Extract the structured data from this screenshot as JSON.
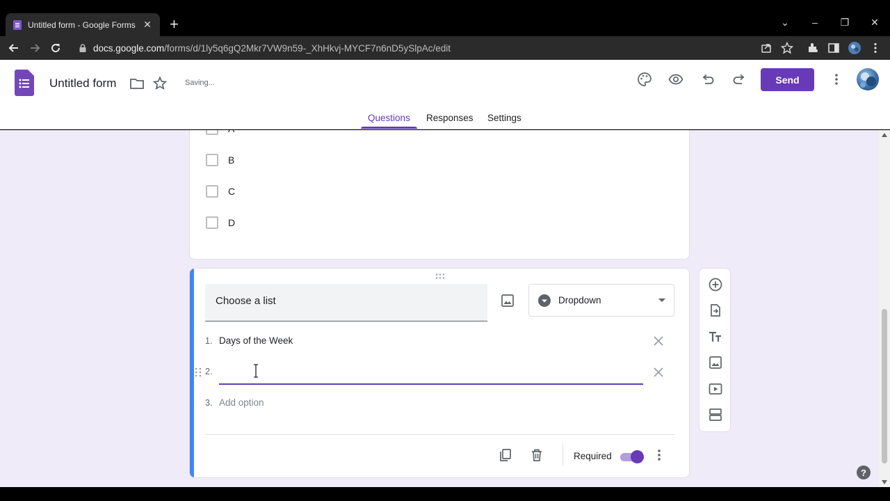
{
  "browser": {
    "tab_title": "Untitled form - Google Forms",
    "url_host": "docs.google.com",
    "url_path": "/forms/d/1ly5q6gQ2Mkr7VW9n59-_XhHkvj-MYCF7n6nD5ySlpAc/edit"
  },
  "header": {
    "form_title": "Untitled form",
    "status": "Saving...",
    "send_label": "Send",
    "tabs": [
      {
        "label": "Questions",
        "active": true
      },
      {
        "label": "Responses",
        "active": false
      },
      {
        "label": "Settings",
        "active": false
      }
    ]
  },
  "previous_question": {
    "options": [
      "A",
      "B",
      "C",
      "D"
    ]
  },
  "question": {
    "title": "Choose a list",
    "type_label": "Dropdown",
    "options": [
      {
        "num": "1.",
        "label": "Days of the Week"
      },
      {
        "num": "2.",
        "label": ""
      }
    ],
    "add_option_num": "3.",
    "add_option_label": "Add option",
    "required_label": "Required",
    "required": true
  },
  "colors": {
    "accent": "#673ab7",
    "focus_bar": "#4285f4",
    "background": "#f0ebf8"
  },
  "help_label": "?"
}
